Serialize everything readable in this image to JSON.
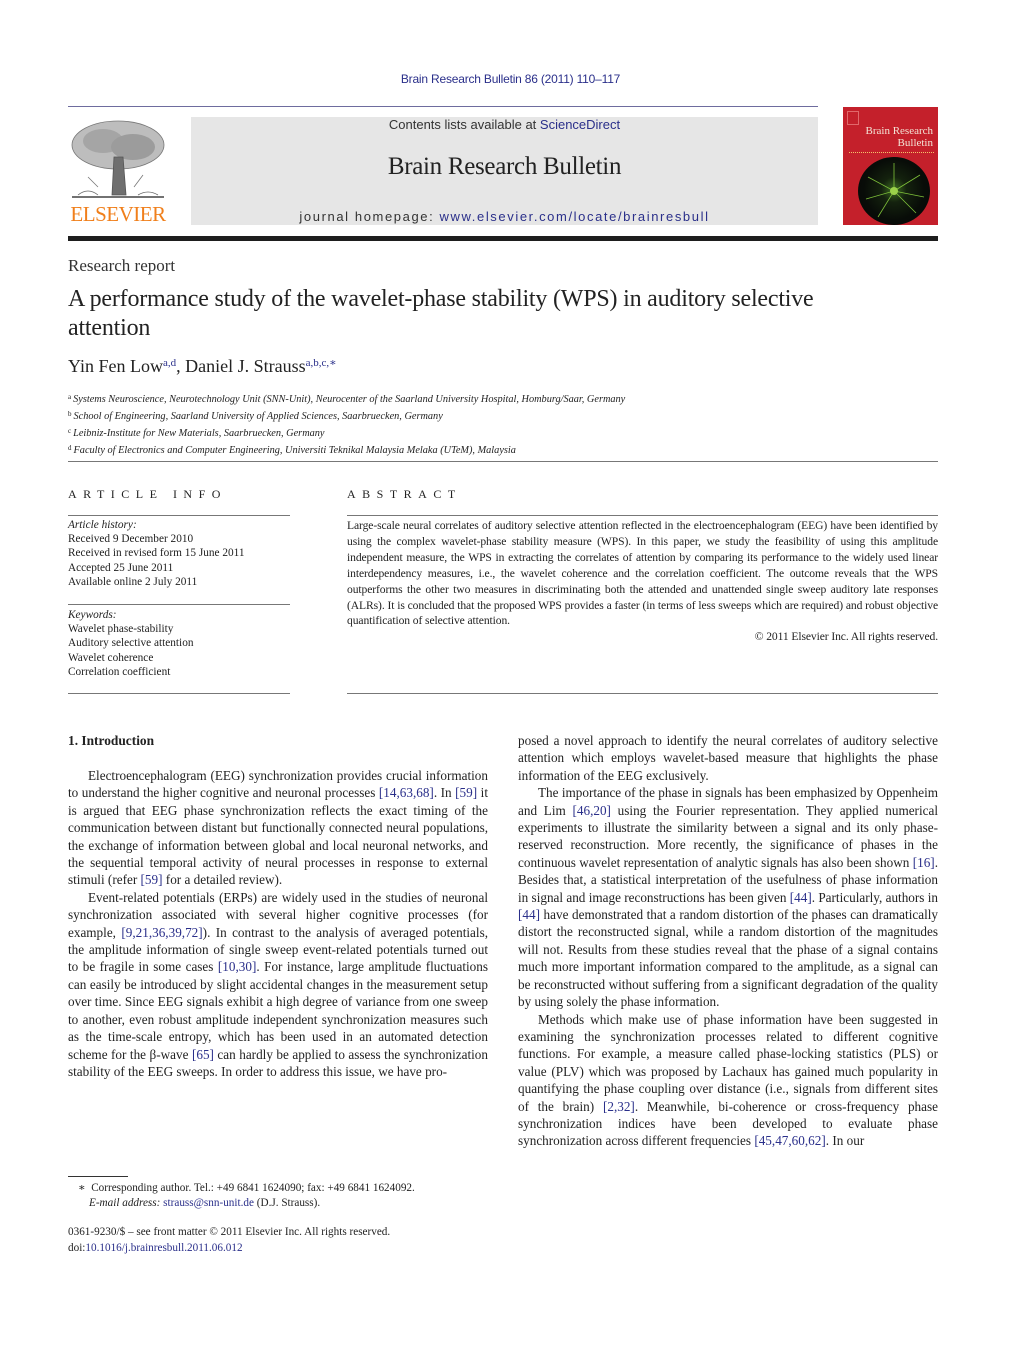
{
  "header": {
    "journal_citation": "Brain Research Bulletin 86 (2011) 110–117",
    "publisher_logo_text": "ELSEVIER",
    "contents_prefix": "Contents lists available at ",
    "contents_link": "ScienceDirect",
    "journal_name": "Brain Research Bulletin",
    "homepage_prefix": "journal homepage: ",
    "homepage_link": "www.elsevier.com/locate/brainresbull",
    "cover_title_line1": "Brain Research",
    "cover_title_line2": "Bulletin"
  },
  "colors": {
    "link": "#2a2f8a",
    "elsevier_orange": "#f07f1b",
    "banner_gray": "#e6e6e6",
    "cover_red": "#c4202b"
  },
  "article": {
    "type": "Research report",
    "title": "A performance study of the wavelet-phase stability (WPS) in auditory selective attention",
    "authors": [
      {
        "name": "Yin Fen Low",
        "affil": "a,d"
      },
      {
        "name": "Daniel J. Strauss",
        "affil": "a,b,c,∗"
      }
    ],
    "author_separator": ", ",
    "affiliations": [
      {
        "key": "a",
        "text": "Systems Neuroscience, Neurotechnology Unit (SNN-Unit), Neurocenter of the Saarland University Hospital, Homburg/Saar, Germany"
      },
      {
        "key": "b",
        "text": "School of Engineering, Saarland University of Applied Sciences, Saarbruecken, Germany"
      },
      {
        "key": "c",
        "text": "Leibniz-Institute for New Materials, Saarbruecken, Germany"
      },
      {
        "key": "d",
        "text": "Faculty of Electronics and Computer Engineering, Universiti Teknikal Malaysia Melaka (UTeM), Malaysia"
      }
    ]
  },
  "article_info": {
    "heading": "ARTICLE INFO",
    "history_label": "Article history:",
    "history": [
      "Received 9 December 2010",
      "Received in revised form 15 June 2011",
      "Accepted 25 June 2011",
      "Available online 2 July 2011"
    ],
    "keywords_label": "Keywords:",
    "keywords": [
      "Wavelet phase-stability",
      "Auditory selective attention",
      "Wavelet coherence",
      "Correlation coefficient"
    ]
  },
  "abstract": {
    "heading": "ABSTRACT",
    "text": "Large-scale neural correlates of auditory selective attention reflected in the electroencephalogram (EEG) have been identified by using the complex wavelet-phase stability measure (WPS). In this paper, we study the feasibility of using this amplitude independent measure, the WPS in extracting the correlates of attention by comparing its performance to the widely used linear interdependency measures, i.e., the wavelet coherence and the correlation coefficient. The outcome reveals that the WPS outperforms the other two measures in discriminating both the attended and unattended single sweep auditory late responses (ALRs). It is concluded that the proposed WPS provides a faster (in terms of less sweeps which are required) and robust objective quantification of selective attention.",
    "copyright": "© 2011 Elsevier Inc. All rights reserved."
  },
  "body": {
    "section_heading": "1.  Introduction",
    "paragraphs": [
      {
        "column": "left",
        "indent": true,
        "segments": [
          {
            "t": "Electroencephalogram (EEG) synchronization provides crucial information to understand the higher cognitive and neuronal processes "
          },
          {
            "t": "[14,63,68]",
            "link": true
          },
          {
            "t": ". In "
          },
          {
            "t": "[59]",
            "link": true
          },
          {
            "t": " it is argued that EEG phase synchronization reflects the exact timing of the communication between distant but functionally connected neural populations, the exchange of information between global and local neuronal networks, and the sequential temporal activity of neural processes in response to external stimuli (refer "
          },
          {
            "t": "[59]",
            "link": true
          },
          {
            "t": " for a detailed review)."
          }
        ]
      },
      {
        "column": "left",
        "indent": true,
        "segments": [
          {
            "t": "Event-related potentials (ERPs) are widely used in the studies of neuronal synchronization associated with several higher cognitive processes (for example, "
          },
          {
            "t": "[9,21,36,39,72]",
            "link": true
          },
          {
            "t": "). In contrast to the analysis of averaged potentials, the amplitude information of single sweep event-related potentials turned out to be fragile in some cases "
          },
          {
            "t": "[10,30]",
            "link": true
          },
          {
            "t": ". For instance, large amplitude fluctuations can easily be introduced by slight accidental changes in the measurement setup over time. Since EEG signals exhibit a high degree of variance from one sweep to another, even robust amplitude independent synchronization measures such as the time-scale entropy, which has been used in an automated detection scheme for the β-wave "
          },
          {
            "t": "[65]",
            "link": true
          },
          {
            "t": " can hardly be applied to assess the synchronization stability of the EEG sweeps. In order to address this issue, we have pro-"
          }
        ]
      },
      {
        "column": "right",
        "indent": false,
        "segments": [
          {
            "t": "posed a novel approach to identify the neural correlates of auditory selective attention which employs wavelet-based measure that highlights the phase information of the EEG exclusively."
          }
        ]
      },
      {
        "column": "right",
        "indent": true,
        "segments": [
          {
            "t": "The importance of the phase in signals has been emphasized by Oppenheim and Lim "
          },
          {
            "t": "[46,20]",
            "link": true
          },
          {
            "t": " using the Fourier representation. They applied numerical experiments to illustrate the similarity between a signal and its only phase-reserved reconstruction. More recently, the significance of phases in the continuous wavelet representation of analytic signals has also been shown "
          },
          {
            "t": "[16]",
            "link": true
          },
          {
            "t": ". Besides that, a statistical interpretation of the usefulness of phase information in signal and image reconstructions has been given "
          },
          {
            "t": "[44]",
            "link": true
          },
          {
            "t": ". Particularly, authors in "
          },
          {
            "t": "[44]",
            "link": true
          },
          {
            "t": " have demonstrated that a random distortion of the phases can dramatically distort the reconstructed signal, while a random distortion of the magnitudes will not. Results from these studies reveal that the phase of a signal contains much more important information compared to the amplitude, as a signal can be reconstructed without suffering from a significant degradation of the quality by using solely the phase information."
          }
        ]
      },
      {
        "column": "right",
        "indent": true,
        "segments": [
          {
            "t": "Methods which make use of phase information have been suggested in examining the synchronization processes related to different cognitive functions. For example, a measure called phase-locking statistics (PLS) or value (PLV) which was proposed by Lachaux has gained much popularity in quantifying the phase coupling over distance (i.e., signals from different sites of the brain) "
          },
          {
            "t": "[2,32]",
            "link": true
          },
          {
            "t": ". Meanwhile, bi-coherence or cross-frequency phase synchronization indices have been developed to evaluate phase synchronization across different frequencies "
          },
          {
            "t": "[45,47,60,62]",
            "link": true
          },
          {
            "t": ". In our"
          }
        ]
      }
    ]
  },
  "footnote": {
    "marker": "∗",
    "corresponding": "Corresponding author. Tel.: +49 6841 1624090; fax: +49 6841 1624092.",
    "email_label": "E-mail address:",
    "email": "strauss@snn-unit.de",
    "email_suffix": " (D.J. Strauss)."
  },
  "front_matter": {
    "issn_line": "0361-9230/$ – see front matter © 2011 Elsevier Inc. All rights reserved.",
    "doi_prefix": "doi:",
    "doi": "10.1016/j.brainresbull.2011.06.012"
  }
}
